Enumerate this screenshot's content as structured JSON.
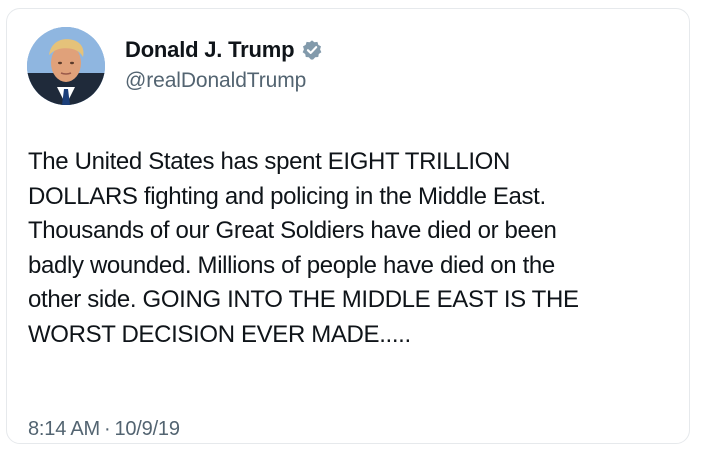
{
  "tweet": {
    "author": {
      "display_name": "Donald J. Trump",
      "handle": "@realDonaldTrump",
      "verified": true,
      "verified_icon": "verified-badge-icon",
      "verified_color": "#829aab",
      "avatar": "profile-photo"
    },
    "text": "The United States has spent EIGHT TRILLION\nDOLLARS fighting and policing in the Middle East.\nThousands of our Great Soldiers have died or been\nbadly wounded. Millions of people have died on the\nother side. GOING INTO THE MIDDLE EAST IS THE\nWORST DECISION EVER MADE.....",
    "time": "8:14 AM",
    "separator": "·",
    "date": "10/9/19"
  },
  "colors": {
    "text_primary": "#0f1419",
    "text_secondary": "#536471",
    "border": "#e6e9ec",
    "background": "#ffffff"
  }
}
